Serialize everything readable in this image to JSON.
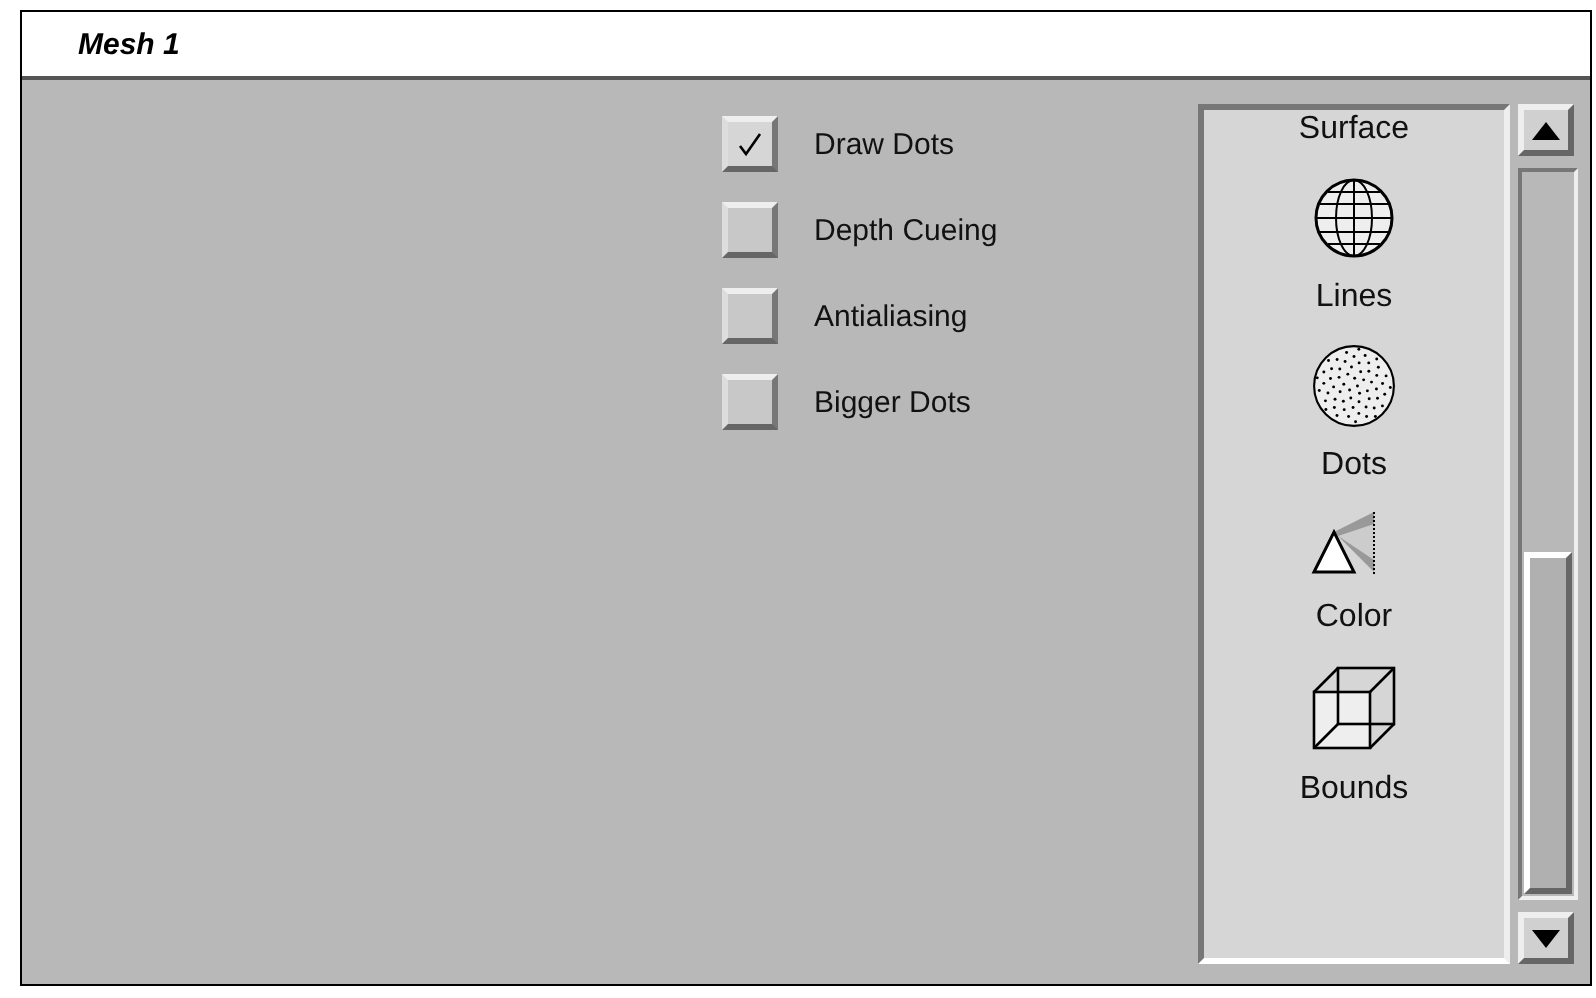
{
  "window": {
    "title": "Mesh 1"
  },
  "options": [
    {
      "label": "Draw Dots",
      "checked": true
    },
    {
      "label": "Depth Cueing",
      "checked": false
    },
    {
      "label": "Antialiasing",
      "checked": false
    },
    {
      "label": "Bigger Dots",
      "checked": false
    }
  ],
  "render_list": {
    "items": [
      {
        "label": "Surface"
      },
      {
        "label": "Lines",
        "kind": "globe"
      },
      {
        "label": "Dots",
        "kind": "dots"
      },
      {
        "label": "Color",
        "kind": "prism"
      },
      {
        "label": "Bounds",
        "kind": "cube"
      }
    ]
  }
}
